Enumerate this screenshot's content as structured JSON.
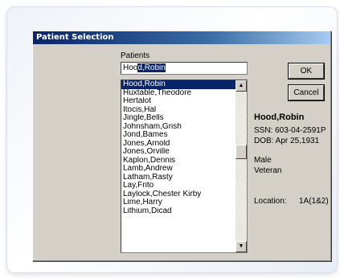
{
  "dialog": {
    "title": "Patient Selection",
    "patients_label": "Patients",
    "search": {
      "prefix": "Hoo",
      "selected": "d,Robin"
    },
    "list_items": [
      "Hood,Robin",
      "Huxtable,Theodore",
      "Hertalot",
      "Itocis,Hal",
      "Jingle,Bells",
      "Johnsham,Grish",
      "Jond,Bames",
      "Jones,Arnold",
      "Jones,Orville",
      "Kaplon,Dennis",
      "Lamb,Andrew",
      "Latham,Rasty",
      "Lay,Frito",
      "Laylock,Chester Kirby",
      "Lime,Harry",
      "Lithium,Dicad"
    ],
    "selected_index": 0,
    "ok_label": "OK",
    "cancel_label": "Cancel",
    "patient": {
      "name": "Hood,Robin",
      "ssn": "SSN:  603-04-2591P",
      "dob": "DOB:  Apr 25,1931",
      "sex": "Male",
      "status": "Veteran",
      "location_label": "Location:",
      "location_value": "1A(1&2)"
    },
    "icons": {
      "scroll_up": "up-arrow-icon",
      "scroll_down": "down-arrow-icon"
    }
  }
}
